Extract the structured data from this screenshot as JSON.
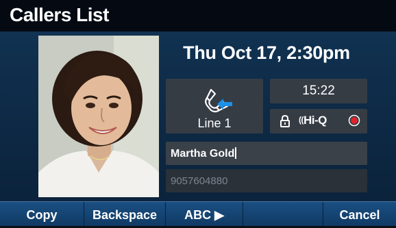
{
  "header": {
    "title": "Callers List"
  },
  "call": {
    "datetime": "Thu Oct 17, 2:30pm",
    "line_label": "Line 1",
    "duration": "15:22",
    "hq_label": "Hi-Q"
  },
  "entry": {
    "name_value": "Martha Gold",
    "number": "9057604880"
  },
  "softkeys": [
    {
      "label": "Copy"
    },
    {
      "label": "Backspace"
    },
    {
      "label": "ABC ▶"
    },
    {
      "label": ""
    },
    {
      "label": "Cancel"
    }
  ],
  "icons": {
    "handset": "phone-handset-icon",
    "incoming_arrow": "incoming-arrow-icon",
    "lock": "lock-icon",
    "hq": "hi-q-icon",
    "record": "record-icon"
  },
  "colors": {
    "accent_arrow": "#1e90e8",
    "record": "#e0242c",
    "softkey_bar": "#144878"
  }
}
